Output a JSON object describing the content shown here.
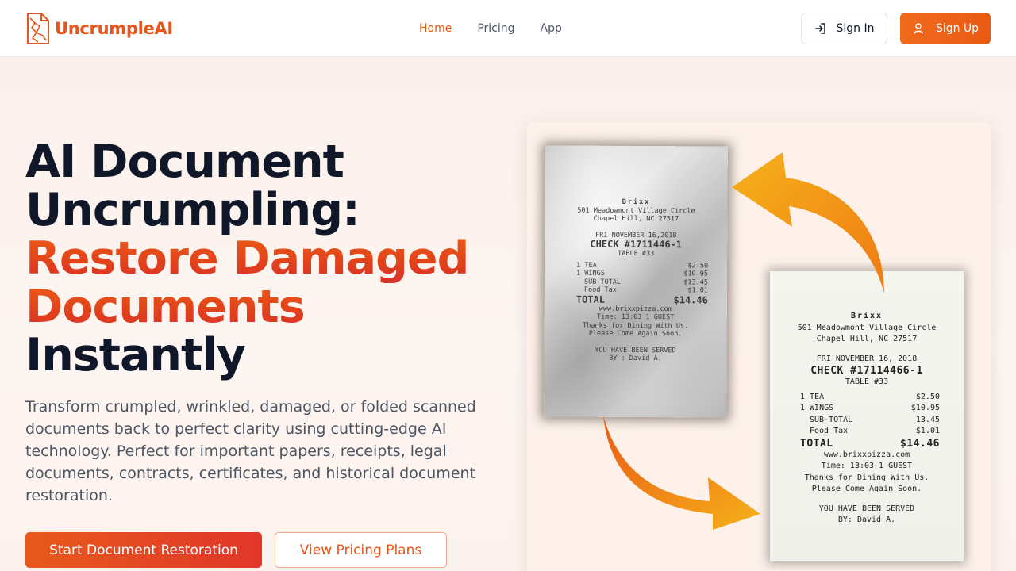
{
  "nav": {
    "brand": "UncrumpleAI",
    "links": [
      "Home",
      "Pricing",
      "App"
    ],
    "signin": "Sign In",
    "signup": "Sign Up"
  },
  "hero": {
    "title_line1": "AI Document",
    "title_line2": "Uncrumpling:",
    "title_line3": "Restore Damaged",
    "title_line4": "Documents",
    "title_line5": "Instantly",
    "description": "Transform crumpled, wrinkled, damaged, or folded scanned documents back to perfect clarity using cutting-edge AI technology. Perfect for important papers, receipts, legal documents, contracts, certificates, and historical document restoration.",
    "primary_cta": "Start Document Restoration",
    "secondary_cta": "View Pricing Plans"
  },
  "receipt": {
    "name": "Brixx",
    "address1": "501 Meadowmont Village Circle",
    "address2": "Chapel Hill, NC 27517",
    "date": "FRI NOVEMBER 16, 2018",
    "check": "CHECK #17114466-1",
    "table": "TABLE #33",
    "items": [
      {
        "label": "1 TEA",
        "price": "$2.50"
      },
      {
        "label": "1 WINGS",
        "price": "$10.95"
      },
      {
        "label": "SUB-TOTAL",
        "price": "13.45"
      },
      {
        "label": "Food Tax",
        "price": "$1.01"
      }
    ],
    "total_label": "TOTAL",
    "total_value": "$14.46",
    "website": "www.brixxpizza.com",
    "time": "Time: 13:03    1 GUEST",
    "thanks1": "Thanks for Dining With Us.",
    "thanks2": "Please Come Again Soon.",
    "served1": "YOU HAVE BEEN SERVED",
    "served2": "BY: David A."
  },
  "crumpled_receipt": {
    "name": "Brixx",
    "address1": "501 Meadowmont Village Circle",
    "address2": "Chapel Hill, NC 27517",
    "date": "FRI NOVEMBER 16,2018",
    "check": "CHECK #1711446-1",
    "table": "TABLE #33",
    "items": [
      {
        "label": "1 TEA",
        "price": "$2.50"
      },
      {
        "label": "1 WINGS",
        "price": "$10.95"
      },
      {
        "label": "SUB-TOTAL",
        "price": "$13.45"
      },
      {
        "label": "Food Tax",
        "price": "$1.01"
      }
    ],
    "total_label": "TOTAL",
    "total_value": "$14.46",
    "website": "www.brixxpizza.com",
    "time": "Time: 13:03    1 GUEST",
    "thanks1": "Thanks for Dining With Us.",
    "thanks2": "Please Come Again Soon.",
    "served1": "YOU HAVE BEEN SERVED",
    "served2": "BY : David A."
  },
  "colors": {
    "brand": "#e8551c",
    "title_dark": "#101729",
    "gradient_start": "#ec5b17",
    "gradient_end": "#d9302a"
  }
}
